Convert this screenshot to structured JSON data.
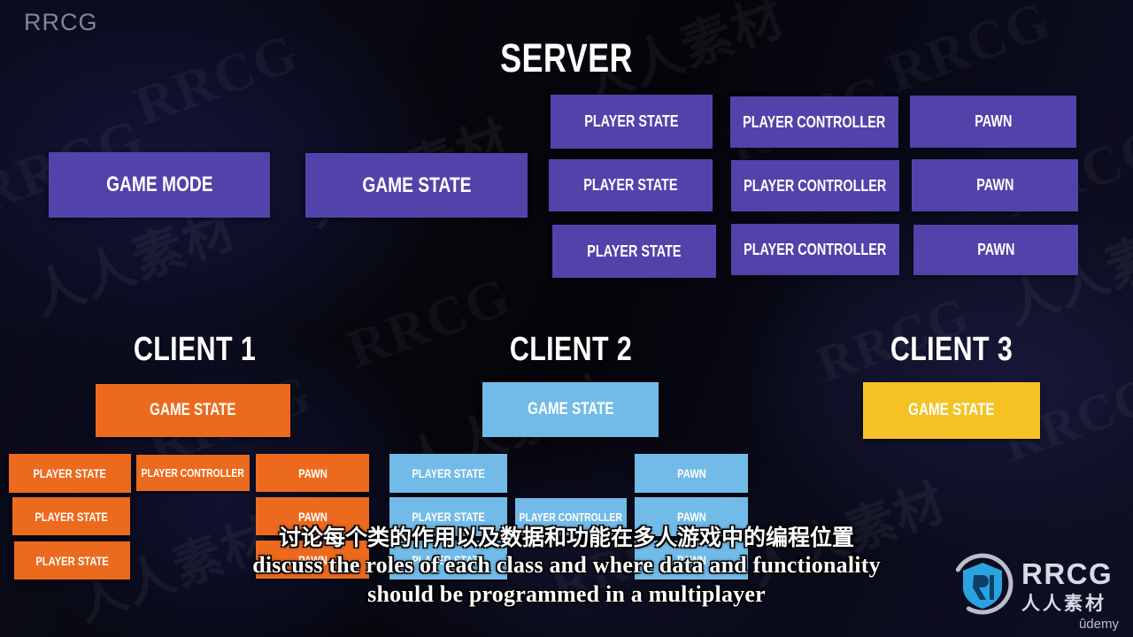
{
  "brand": {
    "top_watermark": "RRCG",
    "logo_text": "RRCG",
    "logo_cn": "人人素材",
    "logo_platform": "ûdemy",
    "logo_icon": "rrcg-shield-icon"
  },
  "watermarks": {
    "latin": "RRCG",
    "cjk": "人人素材"
  },
  "colors": {
    "background": "#07080f",
    "server_box": "#5243ab",
    "client1_box": "#ec6a1e",
    "client2_box": "#72bbe8",
    "client3_box": "#f5c226",
    "title_text": "#ffffff"
  },
  "diagram": {
    "server": {
      "title": "SERVER",
      "global_boxes": [
        {
          "label": "GAME MODE"
        },
        {
          "label": "GAME STATE"
        }
      ],
      "columns": [
        "PLAYER STATE",
        "PLAYER CONTROLLER",
        "PAWN"
      ],
      "rows": [
        {
          "player_state": "PLAYER STATE",
          "player_controller": "PLAYER CONTROLLER",
          "pawn": "PAWN"
        },
        {
          "player_state": "PLAYER STATE",
          "player_controller": "PLAYER CONTROLLER",
          "pawn": "PAWN"
        },
        {
          "player_state": "PLAYER STATE",
          "player_controller": "PLAYER CONTROLLER",
          "pawn": "PAWN"
        }
      ]
    },
    "clients": [
      {
        "title": "CLIENT 1",
        "game_state": "GAME STATE",
        "accent": "#ec6a1e",
        "rows": [
          {
            "player_state": "PLAYER STATE",
            "player_controller": "PLAYER CONTROLLER",
            "pawn": "PAWN"
          },
          {
            "player_state": "PLAYER STATE",
            "player_controller": null,
            "pawn": "PAWN"
          },
          {
            "player_state": "PLAYER STATE",
            "player_controller": null,
            "pawn": "PAWN"
          }
        ]
      },
      {
        "title": "CLIENT 2",
        "game_state": "GAME STATE",
        "accent": "#72bbe8",
        "rows": [
          {
            "player_state": "PLAYER STATE",
            "player_controller": null,
            "pawn": "PAWN"
          },
          {
            "player_state": "PLAYER STATE",
            "player_controller": "PLAYER CONTROLLER",
            "pawn": "PAWN"
          },
          {
            "player_state": "PLAYER STATE",
            "player_controller": null,
            "pawn": "PAWN"
          }
        ]
      },
      {
        "title": "CLIENT 3",
        "game_state": "GAME STATE",
        "accent": "#f5c226",
        "rows": []
      }
    ]
  },
  "subtitles": {
    "chinese": "讨论每个类的作用以及数据和功能在多人游戏中的编程位置",
    "english_line1": "discuss the roles of each class and where data and functionality",
    "english_line2": "should be programmed in a multiplayer"
  }
}
